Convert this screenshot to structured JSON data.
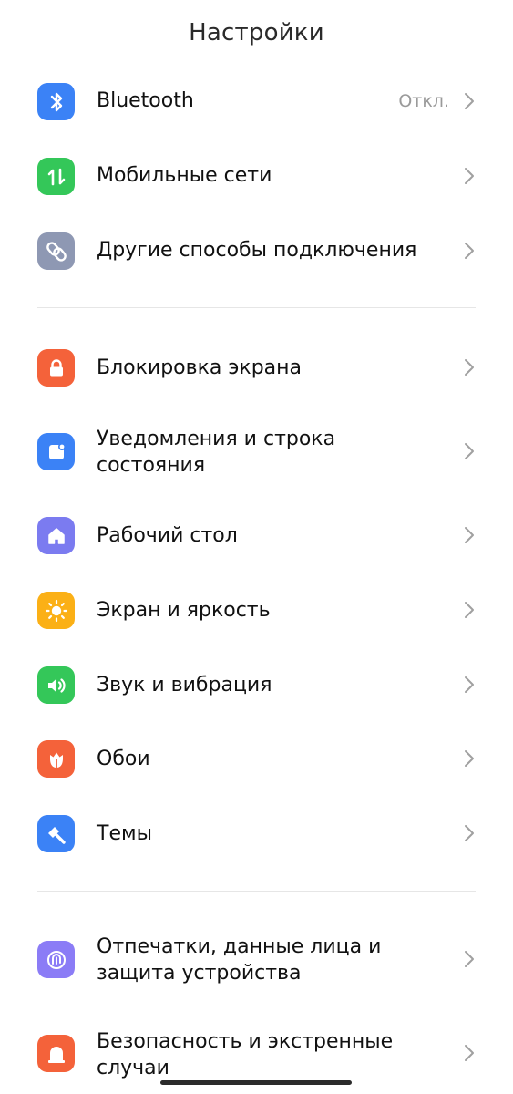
{
  "page": {
    "title": "Настройки"
  },
  "settings": {
    "bluetooth": {
      "label": "Bluetooth",
      "value": "Откл.",
      "icon": "bluetooth-icon",
      "color": "#3b82f6"
    },
    "mobile_networks": {
      "label": "Мобильные сети",
      "icon": "mobile-data-icon",
      "color": "#34c759"
    },
    "other_connections": {
      "label": "Другие способы подключения",
      "icon": "link-icon",
      "color": "#8e98b3"
    },
    "lock_screen": {
      "label": "Блокировка экрана",
      "icon": "lock-icon",
      "color": "#f4623a"
    },
    "notifications": {
      "label_line1": "Уведомления и строка",
      "label_line2": "состояния",
      "icon": "notification-icon",
      "color": "#3b82f6"
    },
    "home_screen": {
      "label": "Рабочий стол",
      "icon": "home-icon",
      "color": "#7b7bf0"
    },
    "display": {
      "label": "Экран и яркость",
      "icon": "sun-icon",
      "color": "#fbb016"
    },
    "sound": {
      "label": "Звук и вибрация",
      "icon": "speaker-icon",
      "color": "#34c759"
    },
    "wallpaper": {
      "label": "Обои",
      "icon": "tulip-icon",
      "color": "#f4623a"
    },
    "themes": {
      "label": "Темы",
      "icon": "brush-icon",
      "color": "#3b82f6"
    },
    "biometrics": {
      "label_line1": "Отпечатки, данные лица и",
      "label_line2": "защита устройства",
      "icon": "fingerprint-icon",
      "color": "#8b7cf6"
    },
    "emergency": {
      "label_line1": "Безопасность и экстренные",
      "label_line2": "случаи",
      "icon": "emergency-icon",
      "color": "#f4623a"
    }
  }
}
